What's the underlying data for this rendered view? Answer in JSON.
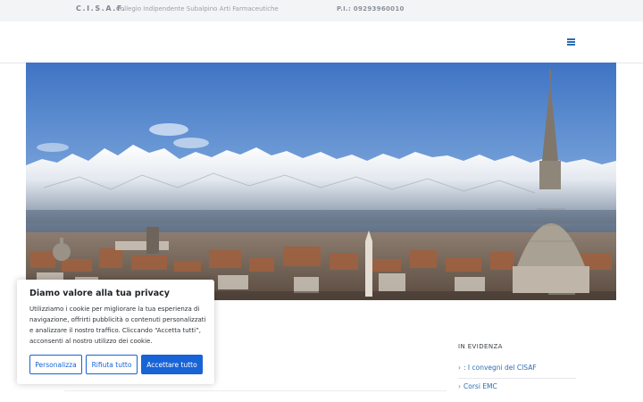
{
  "topbar": {
    "brand": "C.I.S.A.F.",
    "tagline": "Collegio Indipendente Subalpino Arti Farmaceutiche",
    "vat": "P.I.: 09293960010"
  },
  "navbar": {
    "menu_icon": "hamburger-menu-icon"
  },
  "sidebar": {
    "title": "IN EVIDENZA",
    "links": [
      {
        "label": ": I convegni del CISAF"
      },
      {
        "label": "Corsi EMC"
      }
    ]
  },
  "cookie_banner": {
    "title": "Diamo valore alla tua privacy",
    "body": "Utilizziamo i cookie per migliorare la tua esperienza di navigazione, offrirti pubblicità o contenuti personalizzati e analizzare il nostro traffico. Cliccando “Accetta tutti”, acconsenti al nostro utilizzo dei cookie.",
    "buttons": {
      "customize": "Personalizza",
      "reject": "Rifiuta tutto",
      "accept": "Accettare tutto"
    }
  },
  "colors": {
    "accent": "#1863d6",
    "link": "#2d6db5",
    "topbar_bg": "#f3f4f6"
  }
}
